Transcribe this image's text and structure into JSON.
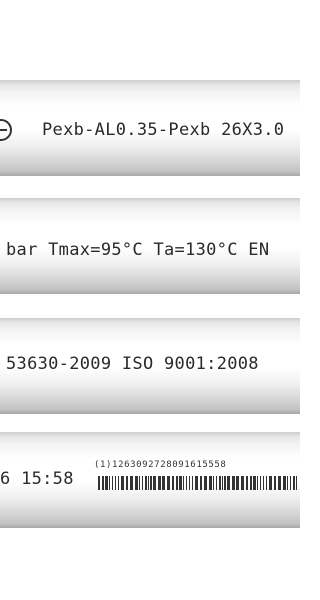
{
  "pipe_markings": [
    {
      "text": "Pexb-AL0.35-Pexb 26X3.0"
    },
    {
      "text": "bar  Tmax=95°C  Ta=130°C  EN"
    },
    {
      "text": "53630-2009  ISO 9001:2008"
    },
    {
      "text": "6 15:58",
      "barcode_text": "(1)1263092728091615558"
    }
  ],
  "colors": {
    "pipe": "#ffffff",
    "ink": "#2a2a2a",
    "background": "#ffffff"
  },
  "icons": {
    "logo": "manufacturer-logo-icon"
  }
}
